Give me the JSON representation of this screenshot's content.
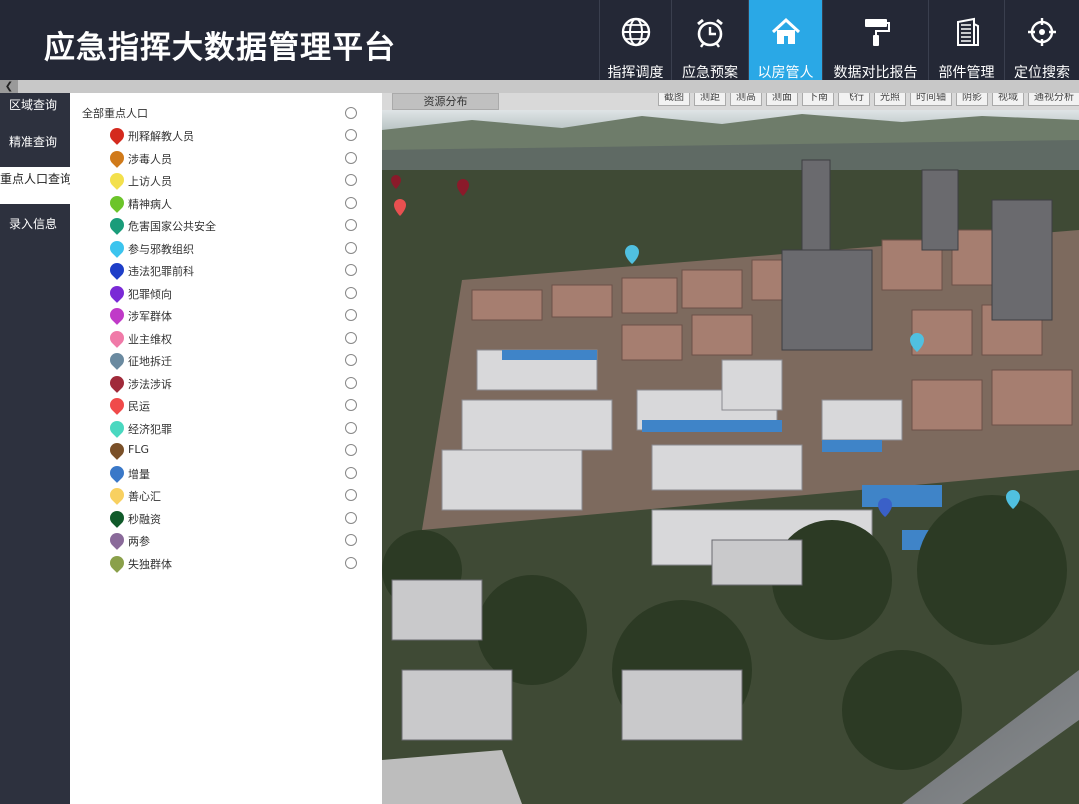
{
  "header": {
    "title": "应急指挥大数据管理平台"
  },
  "nav": [
    {
      "label": "指挥调度",
      "icon": "globe-icon",
      "active": false
    },
    {
      "label": "应急预案",
      "icon": "alarm-clock-icon",
      "active": false
    },
    {
      "label": "以房管人",
      "icon": "home-icon",
      "active": true
    },
    {
      "label": "数据对比报告",
      "icon": "paint-roller-icon",
      "active": false
    },
    {
      "label": "部件管理",
      "icon": "building-icon",
      "active": false
    },
    {
      "label": "定位搜索",
      "icon": "crosshair-icon",
      "active": false
    }
  ],
  "sidebar": {
    "items": [
      {
        "label": "区域查询",
        "active": false
      },
      {
        "label": "精准查询",
        "active": false
      },
      {
        "label": "重点人口查询",
        "active": true
      },
      {
        "label": "录入信息",
        "active": false
      }
    ]
  },
  "panel": {
    "all_label": "全部重点人口",
    "categories": [
      {
        "label": "刑释解教人员",
        "color": "#d42a1e"
      },
      {
        "label": "涉毒人员",
        "color": "#d07a1a"
      },
      {
        "label": "上访人员",
        "color": "#f3e04c"
      },
      {
        "label": "精神病人",
        "color": "#6cc42a"
      },
      {
        "label": "危害国家公共安全",
        "color": "#1a9c7a"
      },
      {
        "label": "参与邪教组织",
        "color": "#3cc4ee"
      },
      {
        "label": "违法犯罪前科",
        "color": "#1e3ec8"
      },
      {
        "label": "犯罪倾向",
        "color": "#7a2ad6"
      },
      {
        "label": "涉军群体",
        "color": "#c03ac8"
      },
      {
        "label": "业主维权",
        "color": "#f07aa8"
      },
      {
        "label": "征地拆迁",
        "color": "#6a8aa0"
      },
      {
        "label": "涉法涉诉",
        "color": "#a02a3a"
      },
      {
        "label": "民运",
        "color": "#f04a4a"
      },
      {
        "label": "经济犯罪",
        "color": "#4ad8c0"
      },
      {
        "label": "FLG",
        "color": "#7a5028"
      },
      {
        "label": "增量",
        "color": "#3a78c8"
      },
      {
        "label": "善心汇",
        "color": "#f8d060"
      },
      {
        "label": "秒融资",
        "color": "#105a2a"
      },
      {
        "label": "两参",
        "color": "#8a6a9a"
      },
      {
        "label": "失独群体",
        "color": "#8aa04a"
      }
    ]
  },
  "map": {
    "resource_tab": "资源分布",
    "tools": [
      "截图",
      "测距",
      "测高",
      "测面",
      "下南",
      "飞行",
      "光照",
      "时间轴",
      "阴影",
      "视域",
      "通视分析"
    ]
  }
}
